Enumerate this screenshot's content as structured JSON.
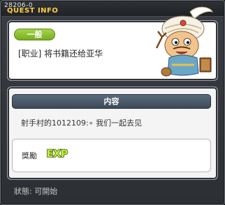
{
  "header": {
    "quest_id": "28206-0",
    "title": "QUEST INFO"
  },
  "quest": {
    "category": "一般",
    "name": "[职业] 将书籍还给亚华"
  },
  "content": {
    "header": "内容",
    "description": "射手村的1012109:∘ 我们一起去见"
  },
  "reward": {
    "label": "獎勵",
    "exp_icon_text": "EXP"
  },
  "status": {
    "text": "狀態: 可開始"
  },
  "colors": {
    "title_gold": "#f2c94c",
    "badge_green": "#8cc43a",
    "content_header": "#4a5a6a"
  },
  "icons": [
    "npc-portrait-icon",
    "exp-icon"
  ]
}
